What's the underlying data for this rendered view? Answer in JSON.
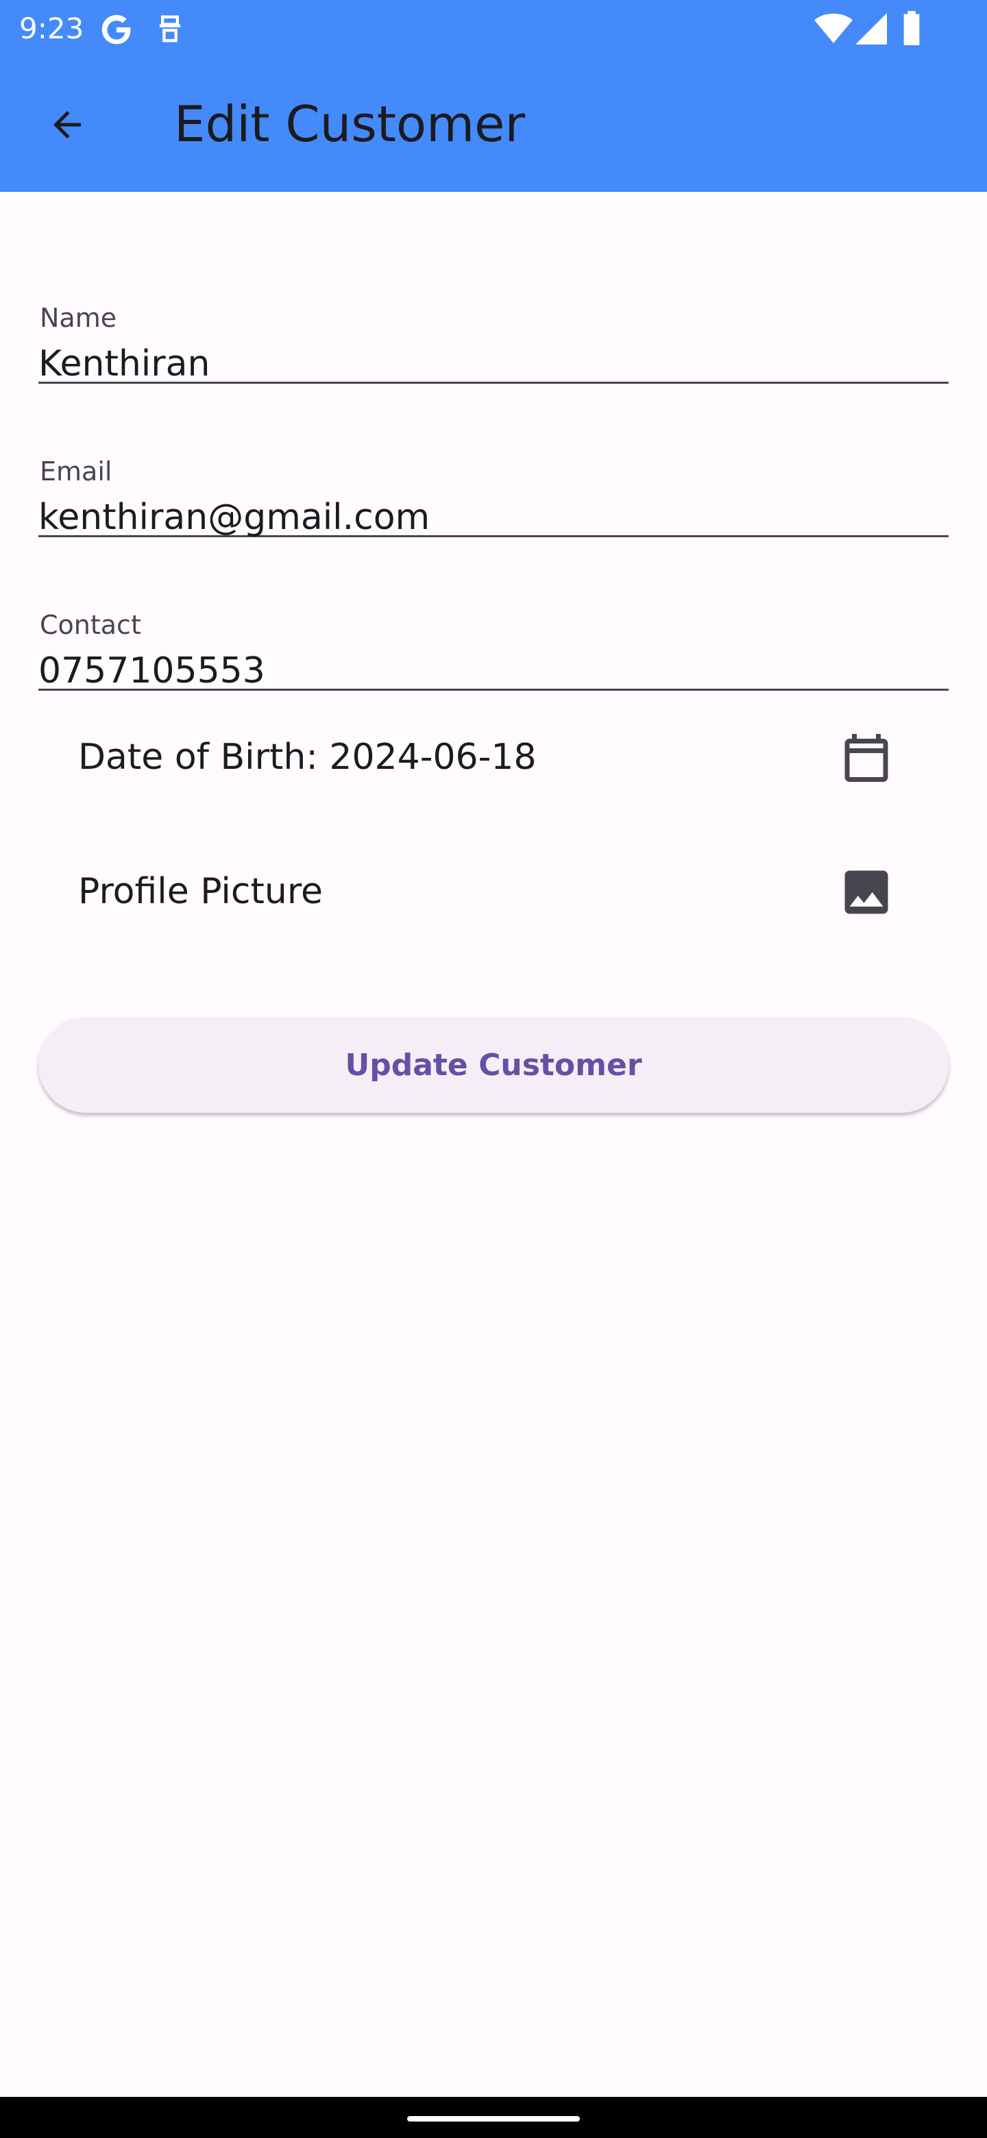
{
  "status_bar": {
    "time": "9:23",
    "icons": [
      "google-icon",
      "accessibility-icon",
      "wifi-icon",
      "signal-icon",
      "battery-icon"
    ]
  },
  "app_bar": {
    "title": "Edit Customer",
    "back_icon": "arrow-back-icon",
    "background": "#448AFA"
  },
  "form": {
    "name": {
      "label": "Name",
      "value": "Kenthiran"
    },
    "email": {
      "label": "Email",
      "value": "kenthiran@gmail.com"
    },
    "contact": {
      "label": "Contact",
      "value": "0757105553"
    },
    "dob": {
      "text": "Date of Birth: 2024-06-18",
      "icon": "calendar-icon"
    },
    "profile_picture": {
      "text": "Profile Picture",
      "icon": "image-icon"
    }
  },
  "actions": {
    "update_label": "Update Customer",
    "accent": "#6650A4"
  }
}
